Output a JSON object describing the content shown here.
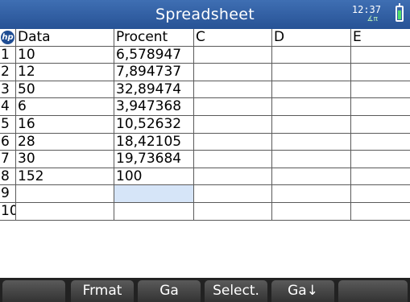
{
  "title": "Spreadsheet",
  "status": {
    "time": "12:37",
    "angle_mode": "∡π",
    "battery_level": 0.8
  },
  "headers": [
    "Data",
    "Procent",
    "C",
    "D",
    "E"
  ],
  "rows": [
    {
      "n": "1",
      "a": "10",
      "b": "6,578947"
    },
    {
      "n": "2",
      "a": "12",
      "b": "7,894737"
    },
    {
      "n": "3",
      "a": "50",
      "b": "32,89474"
    },
    {
      "n": "4",
      "a": "6",
      "b": "3,947368"
    },
    {
      "n": "5",
      "a": "16",
      "b": "10,52632"
    },
    {
      "n": "6",
      "a": "28",
      "b": "18,42105"
    },
    {
      "n": "7",
      "a": "30",
      "b": "19,73684"
    },
    {
      "n": "8",
      "a": "152",
      "b": "100"
    },
    {
      "n": "9",
      "a": "",
      "b": ""
    },
    {
      "n": "10",
      "a": "",
      "b": ""
    }
  ],
  "menu": [
    "",
    "Frmat",
    "Ga",
    "Select.",
    "Ga↓",
    ""
  ]
}
